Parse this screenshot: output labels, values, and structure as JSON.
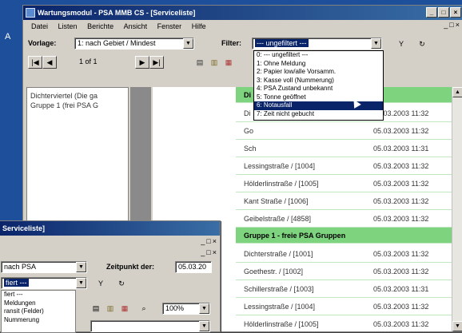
{
  "desktop": {
    "label_a": "A"
  },
  "main_window": {
    "title": "Wartungsmodul - PSA MMB CS - [Serviceliste]",
    "menu": [
      "Datei",
      "Listen",
      "Berichte",
      "Ansicht",
      "Fenster",
      "Hilfe"
    ],
    "vorlage_label": "Vorlage:",
    "vorlage_value": "1: nach Gebiet / Mindest",
    "filter_label": "Filter:",
    "filter_value": "--- ungefiltert ---",
    "pager": {
      "text": "1 of 1",
      "prev": "◀",
      "first": "|◀",
      "next": "▶",
      "last": "▶|"
    },
    "tree": [
      "Dichterviertel (Die ga",
      "Gruppe 1 (frei PSA G"
    ],
    "filter_options": [
      "0: --- ungefiltert ---",
      "1: Ohne Meldung",
      "2: Papier low/alle Vorsamm.",
      "3: Kasse voll (Nummerung)",
      "4: PSA Zustand unbekannt",
      "5: Tonne geöffnet",
      "6: Notausfall",
      "7: Zeit nicht gebucht"
    ],
    "selected_filter_index": 6,
    "group1_header": "Di",
    "rows": [
      {
        "street": "Di",
        "date": "05.03.2003 11:32"
      },
      {
        "street": "Go",
        "date": "05.03.2003 11:32"
      },
      {
        "street": "Sch",
        "date": "05.03.2003 11:31"
      },
      {
        "street": "Lessingstraße / [1004]",
        "date": "05.03.2003 11:32"
      },
      {
        "street": "Hölderlinstraße / [1005]",
        "date": "05.03.2003 11:32"
      },
      {
        "street": "Kant Straße / [1006]",
        "date": "05.03.2003 11:32"
      },
      {
        "street": "Geibelstraße / [4858]",
        "date": "05.03.2003 11:32"
      }
    ],
    "group2_header": "Gruppe 1 - freie PSA Gruppen",
    "rows2": [
      {
        "street": "Dichterstraße / [1001]",
        "date": "05.03.2003 11:32"
      },
      {
        "street": "Goethestr. / [1002]",
        "date": "05.03.2003 11:32"
      },
      {
        "street": "Schillerstraße / [1003]",
        "date": "05.03.2003 11:31"
      },
      {
        "street": "Lessingstraße / [1004]",
        "date": "05.03.2003 11:32"
      },
      {
        "street": "Hölderlinstraße / [1005]",
        "date": "05.03.2003 11:32"
      }
    ]
  },
  "second_window": {
    "title": "Serviceliste]",
    "vorlage_value": "nach PSA",
    "filter_value": "fiert ---",
    "zeitpunkt_label": "Zeitpunkt der:",
    "zeitpunkt_value": "05.03.20",
    "zoom_value": "100%",
    "list": [
      "fiert ---",
      "Meldungen",
      "ransit (Felder)",
      "Nummerung"
    ]
  }
}
